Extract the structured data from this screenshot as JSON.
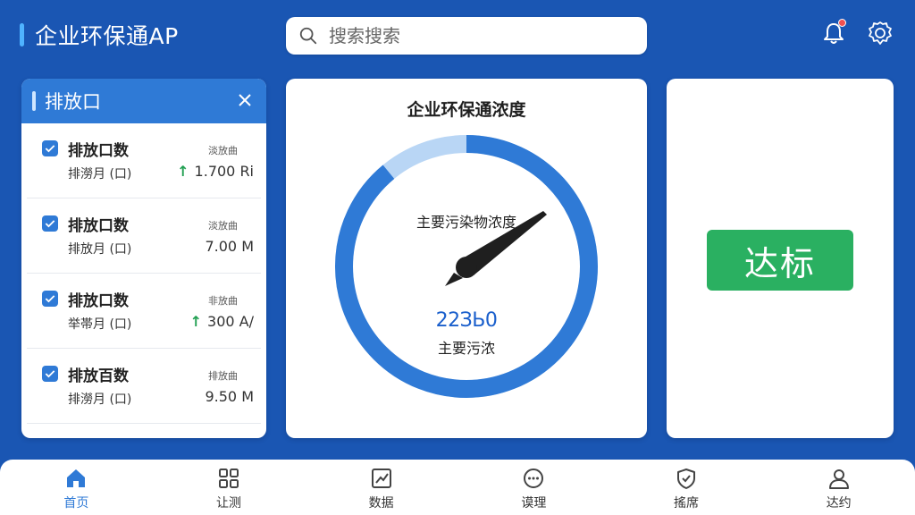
{
  "header": {
    "title": "企业环保通AP",
    "search_placeholder": "搜索搜索"
  },
  "left_panel": {
    "title": "排放口",
    "items": [
      {
        "title": "排放口数",
        "subtitle": "排澇月 (口)",
        "tag": "淡放曲",
        "value": "1.700 Ri",
        "trend": "up",
        "checked": true
      },
      {
        "title": "排放口数",
        "subtitle": "排放月 (口)",
        "tag": "淡放曲",
        "value": "7.00 M",
        "trend": "none",
        "checked": true
      },
      {
        "title": "排放口数",
        "subtitle": "举帯月 (口)",
        "tag": "非放曲",
        "value": "300 A/",
        "trend": "up",
        "checked": true
      },
      {
        "title": "排放百数",
        "subtitle": "排澇月 (口)",
        "tag": "排放曲",
        "value": "9.50 M",
        "trend": "none",
        "checked": true
      }
    ]
  },
  "gauge": {
    "title": "企业环保通浓度",
    "label": "主要污染物浓度",
    "value": "22ЗЬ0",
    "unit": "主要污浓",
    "progress": 0.89
  },
  "status": {
    "label": "达标",
    "color": "#2ab061"
  },
  "nav": {
    "items": [
      {
        "label": "首页",
        "icon": "home-icon",
        "active": true
      },
      {
        "label": "让测",
        "icon": "grid-icon",
        "active": false
      },
      {
        "label": "数据",
        "icon": "chart-icon",
        "active": false
      },
      {
        "label": "谟理",
        "icon": "chat-icon",
        "active": false
      },
      {
        "label": "搖席",
        "icon": "shield-check-icon",
        "active": false
      },
      {
        "label": "达约",
        "icon": "user-icon",
        "active": false
      }
    ]
  },
  "colors": {
    "primary": "#1a56b3",
    "accent": "#2f7ad6",
    "success": "#2ab061"
  }
}
